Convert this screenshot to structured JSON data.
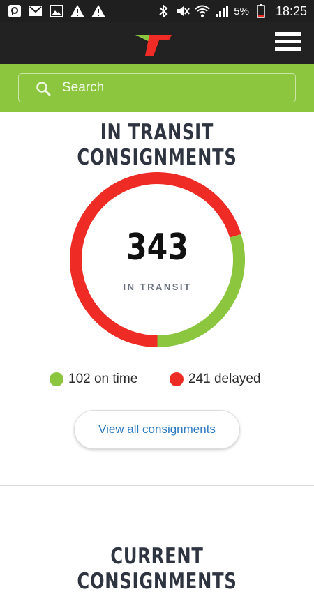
{
  "status_bar": {
    "battery_percent": "5%",
    "time": "18:25",
    "icons": [
      "p-app-icon",
      "mail-icon",
      "image-icon",
      "warning-icon",
      "warning-icon",
      "bluetooth-icon",
      "mute-icon",
      "wifi-icon",
      "signal-icon",
      "battery-icon"
    ]
  },
  "header": {
    "logo": "transnet-logo",
    "menu_icon": "hamburger-menu-icon"
  },
  "search": {
    "placeholder": "Search",
    "value": ""
  },
  "in_transit": {
    "title": "IN TRANSIT CONSIGNMENTS",
    "total": "343",
    "total_label": "IN TRANSIT",
    "legend": {
      "on_time_text": "102 on time",
      "delayed_text": "241 delayed"
    },
    "button_label": "View all consignments"
  },
  "current": {
    "title": "CURRENT CONSIGNMENTS"
  },
  "colors": {
    "accent_green": "#8cc63f",
    "delayed_red": "#ee2b24",
    "dark": "#222222",
    "link_blue": "#2b79c0"
  },
  "chart_data": {
    "type": "pie",
    "categories": [
      "on time",
      "delayed"
    ],
    "values": [
      102,
      241
    ],
    "colors": [
      "#8cc63f",
      "#ee2b24"
    ],
    "total": 343
  }
}
